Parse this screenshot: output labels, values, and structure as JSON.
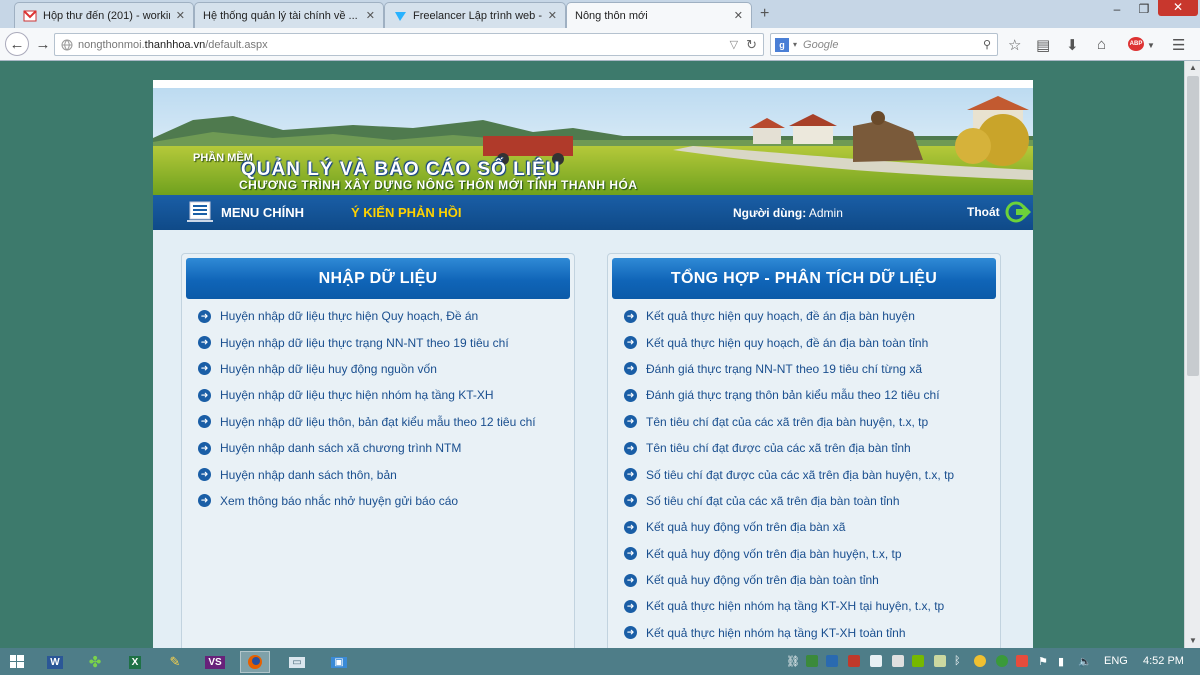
{
  "browser": {
    "tabs": [
      {
        "title": "Hộp thư đến (201) - workin...",
        "active": false,
        "icon": "gmail-icon"
      },
      {
        "title": "Hệ thống quản lý tài chính về ...",
        "active": false,
        "icon": "page-icon"
      },
      {
        "title": "Freelancer Lập trình web - ...",
        "active": false,
        "icon": "freelancer-icon"
      },
      {
        "title": "Nông thôn mới",
        "active": true,
        "icon": "page-icon"
      }
    ],
    "url_prefix": "nongthonmoi.",
    "url_domain": "thanhhoa.vn",
    "url_path": "/default.aspx",
    "search_placeholder": "Google"
  },
  "site": {
    "banner": {
      "label": "PHẦN MỀM",
      "title": "QUẢN LÝ VÀ BÁO CÁO SỐ LIỆU",
      "subtitle": "CHƯƠNG TRÌNH XÂY DỰNG NÔNG THÔN MỚI TỈNH THANH HÓA"
    },
    "menu": {
      "main_label": "MENU CHÍNH",
      "feedback_label": "Ý KIẾN PHẢN HỒI",
      "user_prefix": "Người dùng:",
      "user_name": "Admin",
      "logout_label": "Thoát"
    },
    "left_panel": {
      "title": "NHẬP DỮ LIỆU",
      "links": [
        "Huyện nhập dữ liệu thực hiện Quy hoạch, Đề án",
        "Huyện nhập dữ liệu thực trạng NN-NT theo 19 tiêu chí",
        "Huyện nhập dữ liệu huy động nguồn vốn",
        "Huyện nhập dữ liệu thực hiện nhóm hạ tầng KT-XH",
        "Huyện nhập dữ liệu thôn, bản đạt kiểu mẫu theo 12 tiêu chí",
        "Huyện nhập danh sách xã chương trình NTM",
        "Huyện nhập danh sách thôn, bản",
        "Xem thông báo nhắc nhở huyện gửi báo cáo"
      ]
    },
    "right_panel": {
      "title": "TỔNG HỢP - PHÂN TÍCH DỮ LIỆU",
      "links": [
        "Kết quả thực hiện quy hoạch, đề án địa bàn huyện",
        "Kết quả thực hiện quy hoạch, đề án địa bàn toàn tỉnh",
        "Đánh giá thực trạng NN-NT theo 19 tiêu chí từng xã",
        "Đánh giá thực trạng thôn bản kiểu mẫu theo 12 tiêu chí",
        "Tên tiêu chí đạt của các xã trên địa bàn huyện, t.x, tp",
        "Tên tiêu chí đạt được của các xã trên địa bàn tỉnh",
        "Số tiêu chí đạt được của các xã trên địa bàn huyện, t.x, tp",
        "Số tiêu chí đạt của các xã trên địa bàn toàn tỉnh",
        "Kết quả huy động vốn trên địa bàn xã",
        "Kết quả huy động vốn trên địa bàn huyện, t.x, tp",
        "Kết quả huy động vốn trên địa bàn toàn tỉnh",
        "Kết quả thực hiện nhóm hạ tầng KT-XH tại huyện, t.x, tp",
        "Kết quả thực hiện nhóm hạ tầng KT-XH toàn tỉnh"
      ]
    }
  },
  "taskbar": {
    "language": "ENG",
    "time": "4:52 PM"
  },
  "colors": {
    "menubar": "#0f4a88",
    "panel_header": "#1065b8",
    "link": "#1a4f8f",
    "feedback": "#ffd200",
    "desktop": "#3d7a6c"
  }
}
